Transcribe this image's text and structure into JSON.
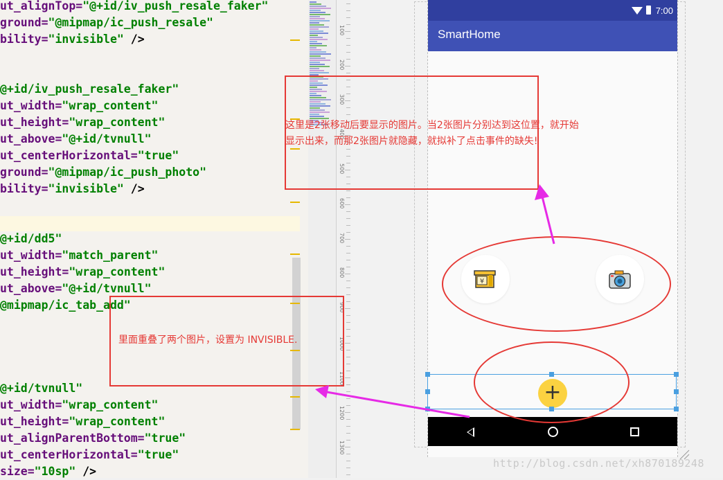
{
  "editor": {
    "lines": [
      {
        "attr": "ut_alignTop=",
        "val": "\"@+id/iv_push_resale_faker\"",
        "tail": ""
      },
      {
        "attr": "ground=",
        "val": "\"@mipmap/ic_push_resale\"",
        "tail": ""
      },
      {
        "attr": "bility=",
        "val": "\"invisible\"",
        "tail": " />"
      },
      {
        "attr": "",
        "val": "",
        "tail": ""
      },
      {
        "attr": "",
        "val": "",
        "tail": ""
      },
      {
        "attr": "",
        "val": "@+id/iv_push_resale_faker\"",
        "tail": ""
      },
      {
        "attr": "ut_width=",
        "val": "\"wrap_content\"",
        "tail": ""
      },
      {
        "attr": "ut_height=",
        "val": "\"wrap_content\"",
        "tail": ""
      },
      {
        "attr": "ut_above=",
        "val": "\"@+id/tvnull\"",
        "tail": ""
      },
      {
        "attr": "ut_centerHorizontal=",
        "val": "\"true\"",
        "tail": ""
      },
      {
        "attr": "ground=",
        "val": "\"@mipmap/ic_push_photo\"",
        "tail": ""
      },
      {
        "attr": "bility=",
        "val": "\"invisible\"",
        "tail": " />"
      },
      {
        "attr": "",
        "val": "",
        "tail": ""
      },
      {
        "attr": "",
        "val": "",
        "tail": ""
      },
      {
        "attr": "",
        "val": "@+id/dd5\"",
        "tail": ""
      },
      {
        "attr": "ut_width=",
        "val": "\"match_parent\"",
        "tail": ""
      },
      {
        "attr": "ut_height=",
        "val": "\"wrap_content\"",
        "tail": ""
      },
      {
        "attr": "ut_above=",
        "val": "\"@+id/tvnull\"",
        "tail": ""
      },
      {
        "attr": "",
        "val": "@mipmap/ic_tab_add\"",
        "tail": ""
      },
      {
        "attr": "",
        "val": "",
        "tail": ""
      },
      {
        "attr": "",
        "val": "",
        "tail": ""
      },
      {
        "attr": "",
        "val": "",
        "tail": ""
      },
      {
        "attr": "",
        "val": "",
        "tail": ""
      },
      {
        "attr": "",
        "val": "@+id/tvnull\"",
        "tail": ""
      },
      {
        "attr": "ut_width=",
        "val": "\"wrap_content\"",
        "tail": ""
      },
      {
        "attr": "ut_height=",
        "val": "\"wrap_content\"",
        "tail": ""
      },
      {
        "attr": "ut_alignParentBottom=",
        "val": "\"true\"",
        "tail": ""
      },
      {
        "attr": "ut_centerHorizontal=",
        "val": "\"true\"",
        "tail": ""
      },
      {
        "attr": "size=",
        "val": "\"10sp\"",
        "tail": " />"
      }
    ]
  },
  "ruler": {
    "labels": [
      "100",
      "200",
      "300",
      "400",
      "500",
      "600",
      "700",
      "800",
      "900",
      "1000",
      "1100",
      "1200",
      "1300"
    ]
  },
  "phone": {
    "status_time": "7:00",
    "app_title": "SmartHome",
    "fab_symbol": "+",
    "colors": {
      "primary": "#3f51b5",
      "primary_dark": "#303f9f",
      "fab": "#fbd241"
    }
  },
  "annotations": {
    "top_note_line1": "这里是2张移动后要显示的图片。当2张图片分别达到这位置，就开始",
    "top_note_line2": "显示出来，而那2张图片就隐藏，就拟补了点击事件的缺失!",
    "left_note": "里面重叠了两个图片，设置为 INVISIBLE.",
    "color": "#e53935",
    "arrow_color": "#e62ae6"
  },
  "watermark": "http://blog.csdn.net/xh870189248"
}
